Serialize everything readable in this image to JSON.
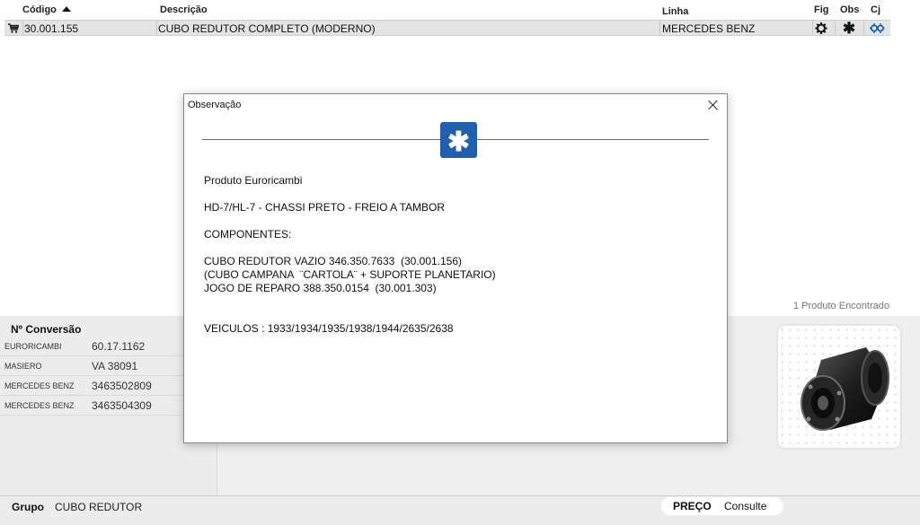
{
  "table": {
    "headers": {
      "code": "Código",
      "description": "Descrição",
      "line": "Linha",
      "fig": "Fig",
      "obs": "Obs",
      "cj": "Cj"
    },
    "row": {
      "code": "30.001.155",
      "description": "CUBO REDUTOR COMPLETO (MODERNO)",
      "line": "MERCEDES BENZ",
      "icons": [
        "cart-icon",
        "gear-icon",
        "asterisk-icon",
        "gears-blue-icon"
      ]
    }
  },
  "results": {
    "found_text": "1 Produto Encontrado"
  },
  "conversion": {
    "title": "Nº Conversão",
    "rows": [
      {
        "brand": "EURORICAMBI",
        "code": "60.17.1162"
      },
      {
        "brand": "MASIERO",
        "code": "VA 38091"
      },
      {
        "brand": "MERCEDES BENZ",
        "code": "3463502809"
      },
      {
        "brand": "MERCEDES BENZ",
        "code": "3463504309"
      }
    ]
  },
  "footer": {
    "group_label": "Grupo",
    "group_value": "CUBO REDUTOR",
    "price_label": "PREÇO",
    "price_value": "Consulte"
  },
  "dialog": {
    "title": "Observação",
    "badge_icon": "asterisk-icon",
    "lines": [
      "Produto Euroricambi",
      "HD-7/HL-7 - CHASSI PRETO - FREIO A TAMBOR",
      "COMPONENTES:",
      "CUBO REDUTOR VAZIO 346.350.7633  (30.001.156)",
      "(CUBO CAMPANA  ¨CARTOLA¨ + SUPORTE PLANETARIO)",
      "JOGO DE REPARO 388.350.0154  (30.001.303)",
      "VEICULOS : 1933/1934/1935/1938/1944/2635/2638"
    ]
  },
  "colors": {
    "accent_blue": "#1f5fae",
    "divider_green": "#2c8a6a",
    "row_highlight": "#e4e4e4"
  }
}
